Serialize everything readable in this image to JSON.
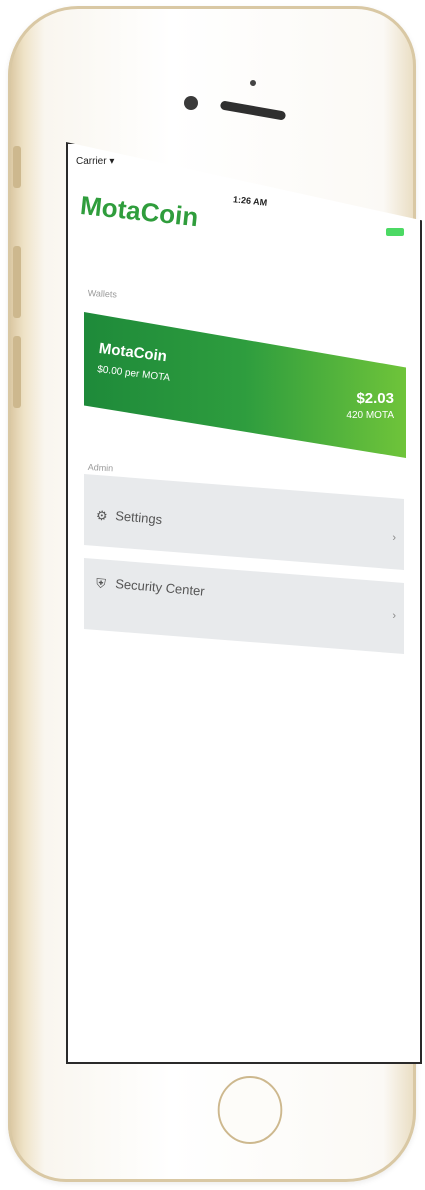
{
  "status": {
    "carrier": "Carrier",
    "wifi_icon": "wifi-icon",
    "time": "1:26 AM",
    "battery_color": "#4cd964"
  },
  "app": {
    "title": "MotaCoin",
    "accent_color": "#2f9d3c"
  },
  "wallets": {
    "section_label": "Wallets",
    "items": [
      {
        "name": "MotaCoin",
        "rate": "$0.00 per MOTA",
        "balance": "$2.03",
        "amount": "420 MOTA"
      }
    ]
  },
  "admin": {
    "section_label": "Admin",
    "items": [
      {
        "label": "Settings",
        "icon": "gear-icon",
        "chevron": "›"
      },
      {
        "label": "Security Center",
        "icon": "shield-icon",
        "chevron": "›"
      }
    ]
  }
}
